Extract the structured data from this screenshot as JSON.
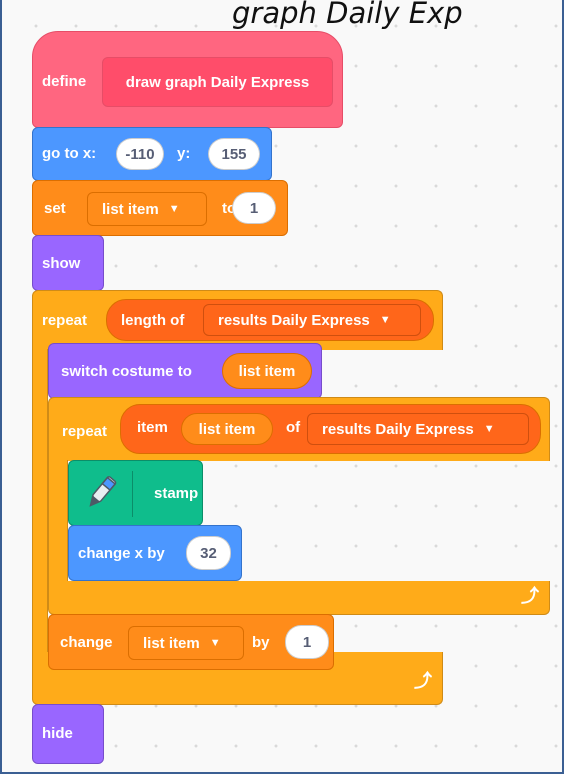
{
  "caption": "graph Daily Exp",
  "script": {
    "define": {
      "keyword": "define",
      "name": "draw graph Daily Express"
    },
    "goto": {
      "label_x": "go to x:",
      "x": "-110",
      "label_y": "y:",
      "y": "155"
    },
    "set": {
      "keyword": "set",
      "variable": "list item",
      "to": "to",
      "value": "1"
    },
    "show": "show",
    "repeat_outer": {
      "keyword": "repeat",
      "length_of": "length of",
      "list": "results Daily Express"
    },
    "switch_costume": {
      "label": "switch costume to",
      "value": "list item"
    },
    "repeat_inner": {
      "keyword": "repeat",
      "item": "item",
      "index": "list item",
      "of": "of",
      "list": "results Daily Express"
    },
    "stamp": "stamp",
    "change_x": {
      "label": "change x by",
      "value": "32"
    },
    "change_var": {
      "keyword": "change",
      "variable": "list item",
      "by": "by",
      "value": "1"
    },
    "hide": "hide"
  },
  "colors": {
    "events_pink": "#ff6680",
    "motion": "#4c97ff",
    "variables": "#ff8c1a",
    "looks": "#9966ff",
    "control": "#ffab19",
    "operators_list": "#ff661a",
    "pen": "#0fbd8c"
  },
  "icons": {
    "pen": "pen-icon",
    "loop_arrow": "loop-arrow-icon",
    "dropdown": "dropdown-arrow-icon"
  }
}
